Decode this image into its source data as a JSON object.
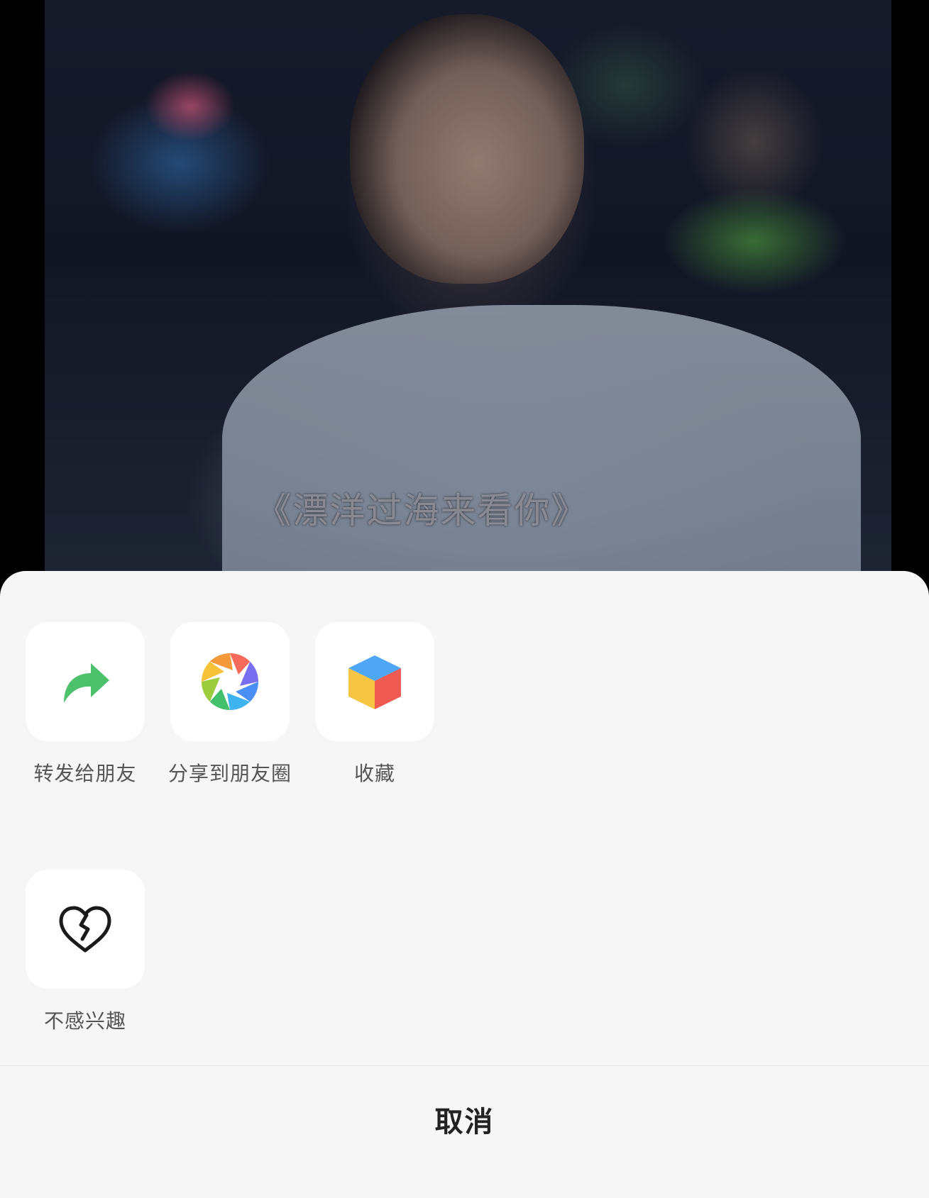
{
  "video": {
    "subtitle": "《漂洋过海来看你》"
  },
  "share_sheet": {
    "actions": [
      {
        "label": "转发给朋友",
        "icon": "forward-arrow-icon",
        "color": "#4cc06a"
      },
      {
        "label": "分享到朋友圈",
        "icon": "moments-aperture-icon"
      },
      {
        "label": "收藏",
        "icon": "favorites-cube-icon"
      },
      {
        "label": "不感兴趣",
        "icon": "broken-heart-icon"
      }
    ],
    "cancel_label": "取消"
  }
}
